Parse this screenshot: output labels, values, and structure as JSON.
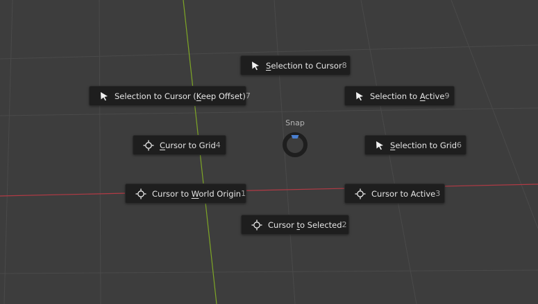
{
  "pie_menu": {
    "title": "Snap",
    "items": [
      {
        "pre": "",
        "ul": "S",
        "post": "election to Cursor",
        "shortcut": "8",
        "icon": "cursor-arrow-icon"
      },
      {
        "pre": "Selection to Cursor (",
        "ul": "K",
        "post": "eep Offset)",
        "shortcut": "7",
        "icon": "cursor-arrow-icon"
      },
      {
        "pre": "Selection to ",
        "ul": "A",
        "post": "ctive",
        "shortcut": "9",
        "icon": "cursor-arrow-icon"
      },
      {
        "pre": "",
        "ul": "C",
        "post": "ursor to Grid",
        "shortcut": "4",
        "icon": "3d-cursor-icon"
      },
      {
        "pre": "",
        "ul": "S",
        "post": "election to Grid",
        "shortcut": "6",
        "icon": "cursor-arrow-icon"
      },
      {
        "pre": "Cursor to ",
        "ul": "W",
        "post": "orld Origin",
        "shortcut": "1",
        "icon": "3d-cursor-icon"
      },
      {
        "pre": "Cursor to Active",
        "ul": "",
        "post": "",
        "shortcut": "3",
        "icon": "3d-cursor-icon"
      },
      {
        "pre": "Cursor ",
        "ul": "t",
        "post": "o Selected",
        "shortcut": "2",
        "icon": "3d-cursor-icon"
      }
    ]
  },
  "colors": {
    "background": "#3d3d3d",
    "grid_line": "#4a4a4a",
    "x_axis": "#b33a45",
    "y_axis": "#7ea626",
    "item_bg": "#1e1e1e",
    "pie_direction_indicator": "#4a7fd0"
  }
}
